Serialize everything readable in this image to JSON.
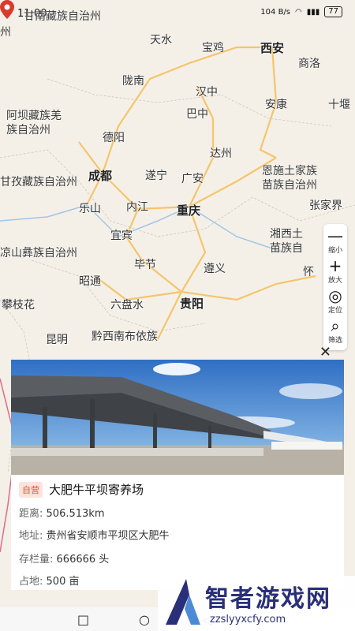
{
  "status": {
    "time": "11:00",
    "net": "104 B/s",
    "battery": "77"
  },
  "map": {
    "cities": [
      {
        "id": "tianshui",
        "name": "天水"
      },
      {
        "id": "baoji",
        "name": "宝鸡"
      },
      {
        "id": "xian",
        "name": "西安"
      },
      {
        "id": "shangluo",
        "name": "商洛"
      },
      {
        "id": "longnan",
        "name": "陇南"
      },
      {
        "id": "hanzhong",
        "name": "汉中"
      },
      {
        "id": "ankang",
        "name": "安康"
      },
      {
        "id": "shiyan",
        "name": "十堰"
      },
      {
        "id": "bazhong",
        "name": "巴中"
      },
      {
        "id": "deyang",
        "name": "德阳"
      },
      {
        "id": "dazhou",
        "name": "达州"
      },
      {
        "id": "chengdu",
        "name": "成都"
      },
      {
        "id": "suining",
        "name": "遂宁"
      },
      {
        "id": "guangan",
        "name": "广安"
      },
      {
        "id": "leshan",
        "name": "乐山"
      },
      {
        "id": "neijiang",
        "name": "内江"
      },
      {
        "id": "chongqing",
        "name": "重庆"
      },
      {
        "id": "zhangjiajie",
        "name": "张家界"
      },
      {
        "id": "yibin",
        "name": "宜宾"
      },
      {
        "id": "bijie",
        "name": "毕节"
      },
      {
        "id": "zunyi",
        "name": "遵义"
      },
      {
        "id": "zhaotong",
        "name": "昭通"
      },
      {
        "id": "liupanshui",
        "name": "六盘水"
      },
      {
        "id": "guiyang",
        "name": "贵阳"
      },
      {
        "id": "panzhihua",
        "name": "攀枝花"
      },
      {
        "id": "kunming",
        "name": "昆明"
      }
    ],
    "regions": [
      {
        "id": "gannan",
        "text": "甘南藏族自治州"
      },
      {
        "id": "aba",
        "text": "阿坝藏族羌\n族自治州"
      },
      {
        "id": "ganzi",
        "text": "甘孜藏族自治州"
      },
      {
        "id": "enshi",
        "text": "恩施土家族\n苗族自治州"
      },
      {
        "id": "xiangxi",
        "text": "湘西土\n苗族自"
      },
      {
        "id": "liangshan",
        "text": "凉山彝族自治州"
      },
      {
        "id": "qiannan",
        "text": "黔西南布依族"
      },
      {
        "id": "zhou",
        "text": "州"
      },
      {
        "id": "huai",
        "text": "怀"
      }
    ]
  },
  "controls": {
    "zoom_out": {
      "glyph": "—",
      "label": "缩小"
    },
    "zoom_in": {
      "glyph": "+",
      "label": "放大"
    },
    "locate": {
      "glyph": "◎",
      "label": "定位"
    },
    "filter": {
      "glyph": "⌕",
      "label": "筛选"
    },
    "close": "✕"
  },
  "card": {
    "badge": "自营",
    "title": "大肥牛平坝寄养场",
    "distance_label": "距离:",
    "distance": "506.513km",
    "address_label": "地址:",
    "address": "贵州省安顺市平坝区大肥牛",
    "stock_label": "存栏量:",
    "stock": "666666 头",
    "area_label": "占地:",
    "area": "500 亩"
  },
  "nav": {
    "square": "□",
    "circle": "○",
    "back": "◁"
  },
  "brand": {
    "name": "智者游戏网",
    "url": "zzslyyxcfy.com"
  },
  "colors": {
    "accent": "#e0563a",
    "pin": "#d93a2b",
    "brand": "#2a2f7a"
  }
}
